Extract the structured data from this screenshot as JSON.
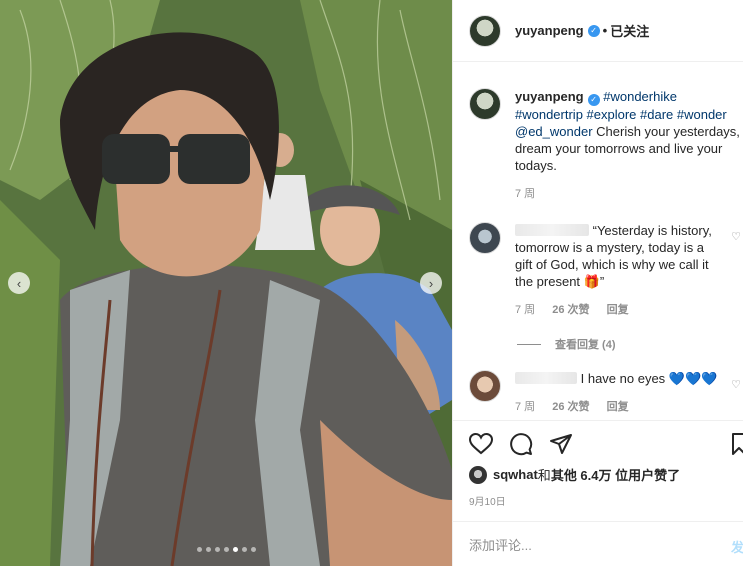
{
  "post": {
    "username": "yuyanpeng",
    "separator": "•",
    "follow_label": "已关注"
  },
  "caption": {
    "username": "yuyanpeng",
    "hashtags_line1": "#wonderhike",
    "hashtags_line2": "#wondertrip #explore #dare #wonder",
    "mention": "@ed_wonder",
    "text": " Cherish your yesterdays, dream your tomorrows and live your todays.",
    "time": "7 周"
  },
  "comments": [
    {
      "text": "“Yesterday is history, tomorrow  is a mystery, today is a gift of God, which is why we call it the present 🎁”",
      "time": "7 周",
      "likes": "26 次赞",
      "reply": "回复"
    },
    {
      "text": "I have no eyes 💙💙💙",
      "time": "7 周",
      "likes": "26 次赞",
      "reply": "回复"
    }
  ],
  "view_replies": "查看回复 (4)",
  "likes_line": {
    "user": "sqwhat",
    "and": " 和 ",
    "others": "其他 6.4万 位用户",
    "suffix": " 赞了"
  },
  "date": "9月10日",
  "add_comment": {
    "placeholder": "添加评论...",
    "post_label": "发"
  },
  "carousel": {
    "count": 7,
    "active_index": 4
  },
  "icons": {
    "verified": "verified-badge-icon",
    "heart": "heart-icon",
    "comment": "comment-icon",
    "share": "paper-plane-icon",
    "bookmark": "bookmark-icon",
    "prev": "chevron-left-icon",
    "next": "chevron-right-icon"
  },
  "colors": {
    "link": "#00376b",
    "verified": "#3897f0",
    "post_button": "#b2dffc"
  }
}
